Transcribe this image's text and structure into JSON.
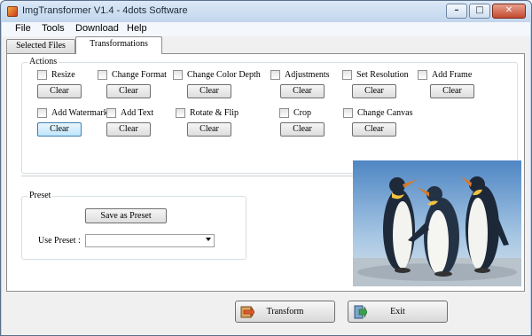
{
  "window": {
    "title": "ImgTransformer V1.4 - 4dots Software",
    "minimize_glyph": "–",
    "maximize_glyph": "□",
    "close_glyph": "✕"
  },
  "menu": [
    "File",
    "Tools",
    "Download",
    "Help"
  ],
  "tabs": [
    {
      "label": "Selected Files",
      "active": false
    },
    {
      "label": "Transformations",
      "active": true
    }
  ],
  "actions": {
    "title": "Actions",
    "items": [
      {
        "label": "Resize",
        "checked": false,
        "clear": "Clear"
      },
      {
        "label": "Change Format",
        "checked": false,
        "clear": "Clear"
      },
      {
        "label": "Change Color Depth",
        "checked": false,
        "clear": "Clear"
      },
      {
        "label": "Adjustments",
        "checked": false,
        "clear": "Clear"
      },
      {
        "label": "Set Resolution",
        "checked": false,
        "clear": "Clear"
      },
      {
        "label": "Add Frame",
        "checked": false,
        "clear": "Clear"
      },
      {
        "label": "Add Watermark",
        "checked": false,
        "clear": "Clear"
      },
      {
        "label": "Add Text",
        "checked": false,
        "clear": "Clear"
      },
      {
        "label": "Rotate & Flip",
        "checked": false,
        "clear": "Clear"
      },
      {
        "label": "Crop",
        "checked": false,
        "clear": "Clear"
      },
      {
        "label": "Change Canvas",
        "checked": false,
        "clear": "Clear"
      }
    ]
  },
  "preset": {
    "title": "Preset",
    "save_label": "Save as Preset",
    "use_label": "Use Preset :",
    "selected_value": ""
  },
  "buttons": {
    "transform": "Transform",
    "exit": "Exit"
  },
  "colors": {
    "titlebar": "#c2d6ec",
    "window_border": "#5a6f8a",
    "focused_button": "#bee6fd",
    "close_button": "#c44a2f"
  }
}
